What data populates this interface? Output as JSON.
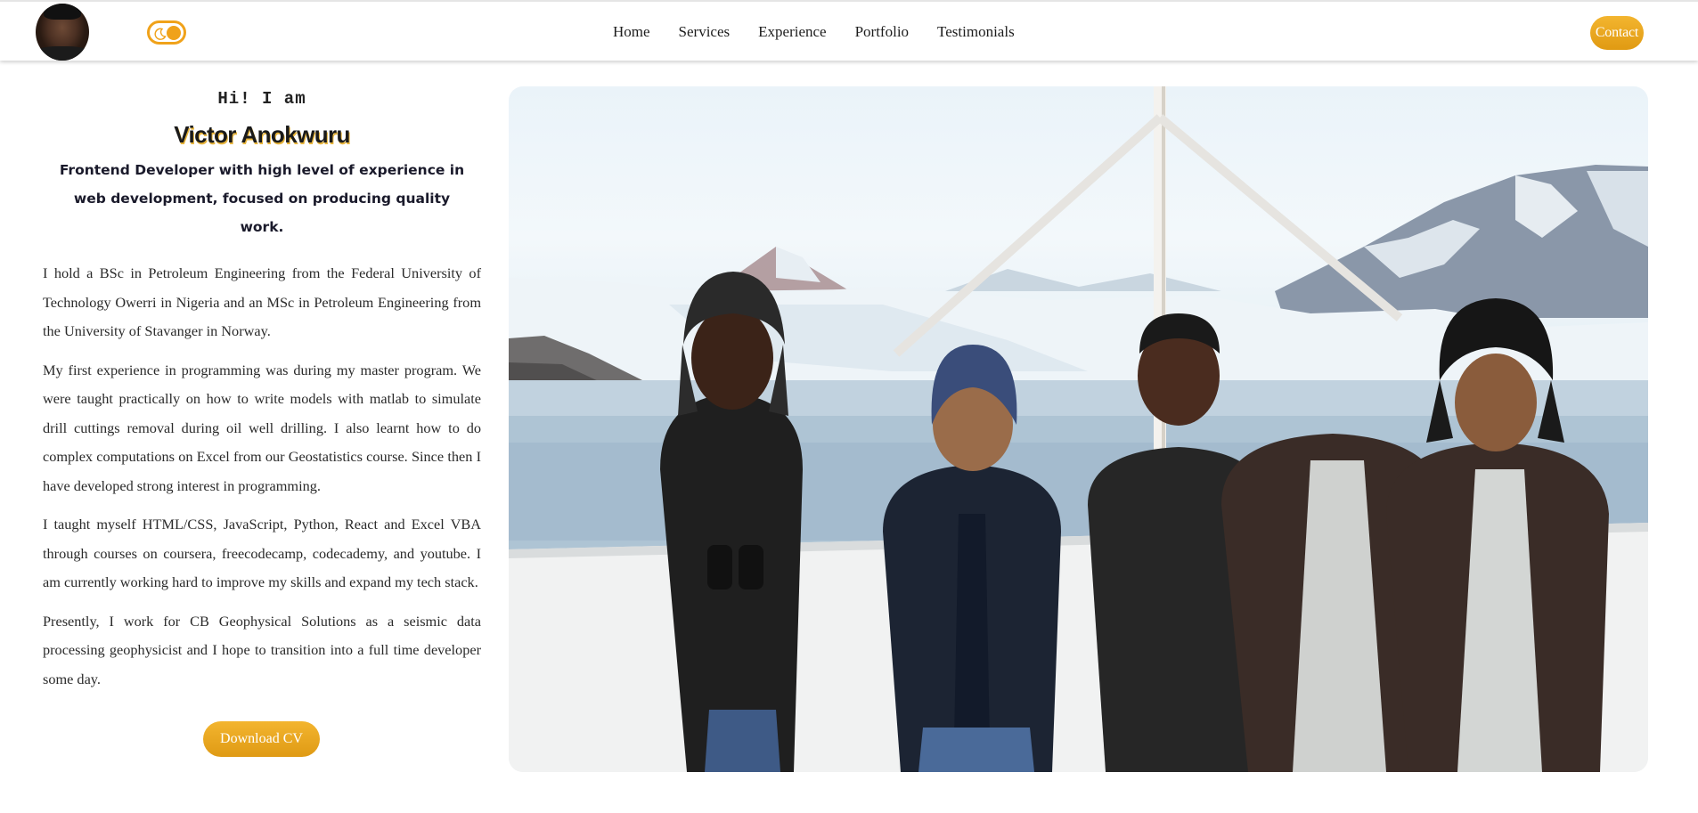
{
  "header": {
    "avatar_alt": "Victor Anokwuru avatar",
    "nav": [
      {
        "label": "Home"
      },
      {
        "label": "Services"
      },
      {
        "label": "Experience"
      },
      {
        "label": "Portfolio"
      },
      {
        "label": "Testimonials"
      }
    ],
    "contact_label": "Contact"
  },
  "hero": {
    "greeting": "Hi! I am",
    "name": "Victor Anokwuru",
    "tagline": "Frontend Developer with high level of experience in web development, focused on producing quality work.",
    "bio": [
      "I hold a BSc in Petroleum Engineering from the Federal University of Technology Owerri in Nigeria and an MSc in Petroleum Engineering from the University of Stavanger in Norway.",
      "My first experience in programming was during my master program. We were taught practically on how to write models with matlab to simulate drill cuttings removal during oil well drilling. I also learnt how to do complex computations on Excel from our Geostatistics course. Since then I have developed strong interest in programming.",
      "I taught myself HTML/CSS, JavaScript, Python, React and Excel VBA through courses on coursera, freecodecamp, codecademy, and youtube. I am currently working hard to improve my skills and expand my tech stack.",
      "Presently, I work for CB Geophysical Solutions as a seismic data processing geophysicist and I hope to transition into a full time developer some day."
    ],
    "download_label": "Download CV"
  },
  "colors": {
    "accent": "#f0a21a",
    "text": "#222222"
  },
  "icons": {
    "theme_toggle": "moon-toggle-icon"
  }
}
